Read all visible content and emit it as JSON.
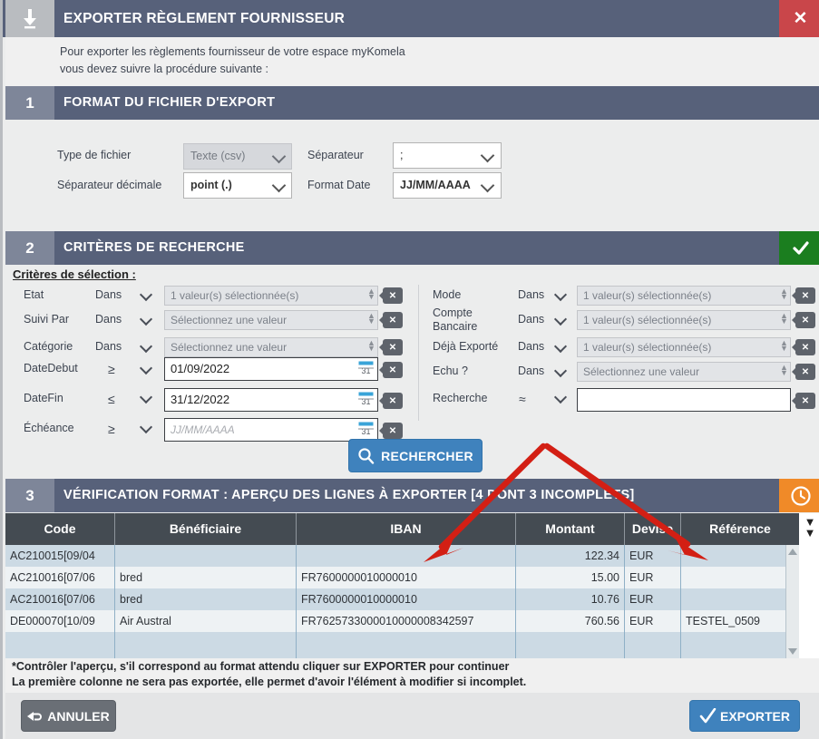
{
  "window": {
    "title": "EXPORTER RÈGLEMENT FOURNISSEUR",
    "download_icon": "download-icon",
    "close_label": "✕"
  },
  "intro": {
    "line1": "Pour exporter les règlements fournisseur de votre espace myKomela",
    "line2": "vous devez suivre la procédure suivante :"
  },
  "section1": {
    "number": "1",
    "title": "FORMAT DU FICHIER D'EXPORT",
    "fields": {
      "type_label": "Type de fichier",
      "type_value": "Texte (csv)",
      "separator_label": "Séparateur",
      "separator_value": ";",
      "decimal_label": "Séparateur décimale",
      "decimal_value": "point (.)",
      "dateformat_label": "Format Date",
      "dateformat_value": "JJ/MM/AAAA"
    }
  },
  "section2": {
    "number": "2",
    "title": "CRITÈRES DE RECHERCHE",
    "badge_icon": "check-icon",
    "badge_color": "#1b7e1f",
    "criteria_title": "Critères de sélection :",
    "left_rows": [
      {
        "label": "Etat",
        "operator": "Dans",
        "value": "1 valeur(s) sélectionnée(s)",
        "kind": "multiselect"
      },
      {
        "label": "Suivi Par",
        "operator": "Dans",
        "value": "Sélectionnez une valeur",
        "kind": "multiselect"
      },
      {
        "label": "Catégorie",
        "operator": "Dans",
        "value": "Sélectionnez une valeur",
        "kind": "multiselect"
      },
      {
        "label": "DateDebut",
        "operator": "≥",
        "value": "01/09/2022",
        "kind": "date"
      },
      {
        "label": "DateFin",
        "operator": "≤",
        "value": "31/12/2022",
        "kind": "date"
      },
      {
        "label": "Échéance",
        "operator": "≥",
        "value": "JJ/MM/AAAA",
        "kind": "date-placeholder"
      }
    ],
    "right_rows": [
      {
        "label": "Mode",
        "operator": "Dans",
        "value": "1 valeur(s) sélectionnée(s)",
        "kind": "multiselect"
      },
      {
        "label": "Compte Bancaire",
        "operator": "Dans",
        "value": "1 valeur(s) sélectionnée(s)",
        "kind": "multiselect"
      },
      {
        "label": "Déjà Exporté",
        "operator": "Dans",
        "value": "1 valeur(s) sélectionnée(s)",
        "kind": "multiselect"
      },
      {
        "label": "Echu ?",
        "operator": "Dans",
        "value": "Sélectionnez une valeur",
        "kind": "multiselect"
      },
      {
        "label": "Recherche",
        "operator": "≈",
        "value": "",
        "kind": "text"
      }
    ],
    "search_button": "RECHERCHER",
    "search_icon": "magnifier-icon"
  },
  "section3": {
    "number": "3",
    "title": "VÉRIFICATION FORMAT : APERÇU DES LIGNES À EXPORTER [4 DONT 3 INCOMPLETS]",
    "badge_icon": "clock-icon",
    "badge_color": "#f08a28",
    "columns": [
      "Code",
      "Bénéficiaire",
      "IBAN",
      "Montant",
      "Devise",
      "Référence"
    ],
    "rows": [
      {
        "code": "AC210015[09/04",
        "beneficiaire": "",
        "iban": "",
        "montant": "122.34",
        "devise": "EUR",
        "reference": ""
      },
      {
        "code": "AC210016[07/06",
        "beneficiaire": "bred",
        "iban": "FR7600000010000010",
        "montant": "15.00",
        "devise": "EUR",
        "reference": ""
      },
      {
        "code": "AC210016[07/06",
        "beneficiaire": "bred",
        "iban": "FR7600000010000010",
        "montant": "10.76",
        "devise": "EUR",
        "reference": ""
      },
      {
        "code": "DE000070[10/09",
        "beneficiaire": "Air Austral",
        "iban": "FR7625733000010000008342597",
        "montant": "760.56",
        "devise": "EUR",
        "reference": "TESTEL_0509"
      },
      {
        "code": "",
        "beneficiaire": "",
        "iban": "",
        "montant": "",
        "devise": "",
        "reference": ""
      }
    ]
  },
  "footnote": {
    "line1": "*Contrôler l'aperçu, s'il correspond au format attendu cliquer sur EXPORTER pour continuer",
    "line2": "La première colonne ne sera pas exportée, elle permet d'avoir l'élément à modifier si incomplet."
  },
  "footer": {
    "cancel_label": "ANNULER",
    "cancel_icon": "back-arrow-icon",
    "export_label": "EXPORTER",
    "export_icon": "check-icon"
  },
  "annotations": {
    "arrow_color": "#d31f14",
    "arrow_count": 2
  }
}
